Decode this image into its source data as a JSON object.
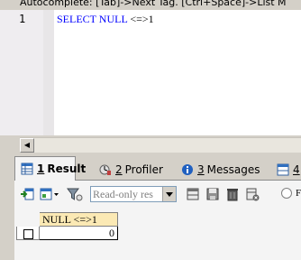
{
  "hint": {
    "text": "Autocomplete: [Tab]->Next Tag. [Ctrl+Space]->List M"
  },
  "editor": {
    "line_number": "1",
    "code": {
      "keyword": "SELECT NULL",
      "rest": " <=>1"
    }
  },
  "tabs": [
    {
      "number": "1",
      "label": "Result",
      "icon": "grid-icon"
    },
    {
      "number": "2",
      "label": "Profiler",
      "icon": "profiler-icon"
    },
    {
      "number": "3",
      "label": "Messages",
      "icon": "info-icon"
    },
    {
      "number": "4",
      "label": "",
      "icon": "table-icon"
    }
  ],
  "toolbar": {
    "readonly_placeholder": "Read-only res",
    "radio_label": "F"
  },
  "grid": {
    "columns": [
      "NULL <=>1"
    ],
    "rows": [
      {
        "values": [
          "0"
        ]
      }
    ]
  },
  "colors": {
    "keyword": "#0000ff",
    "header_bg": "#fbe9b4",
    "panel_bg": "#d4d0c8"
  }
}
